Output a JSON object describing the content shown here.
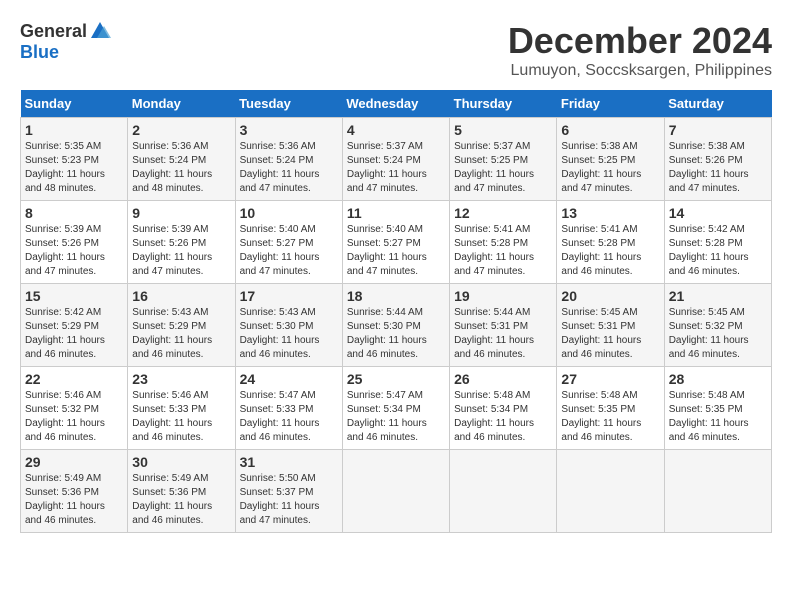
{
  "header": {
    "logo_general": "General",
    "logo_blue": "Blue",
    "title": "December 2024",
    "location": "Lumuyon, Soccsksargen, Philippines"
  },
  "days_of_week": [
    "Sunday",
    "Monday",
    "Tuesday",
    "Wednesday",
    "Thursday",
    "Friday",
    "Saturday"
  ],
  "weeks": [
    [
      {
        "day": "1",
        "sunrise": "5:35 AM",
        "sunset": "5:23 PM",
        "daylight": "11 hours and 48 minutes."
      },
      {
        "day": "2",
        "sunrise": "5:36 AM",
        "sunset": "5:24 PM",
        "daylight": "11 hours and 48 minutes."
      },
      {
        "day": "3",
        "sunrise": "5:36 AM",
        "sunset": "5:24 PM",
        "daylight": "11 hours and 47 minutes."
      },
      {
        "day": "4",
        "sunrise": "5:37 AM",
        "sunset": "5:24 PM",
        "daylight": "11 hours and 47 minutes."
      },
      {
        "day": "5",
        "sunrise": "5:37 AM",
        "sunset": "5:25 PM",
        "daylight": "11 hours and 47 minutes."
      },
      {
        "day": "6",
        "sunrise": "5:38 AM",
        "sunset": "5:25 PM",
        "daylight": "11 hours and 47 minutes."
      },
      {
        "day": "7",
        "sunrise": "5:38 AM",
        "sunset": "5:26 PM",
        "daylight": "11 hours and 47 minutes."
      }
    ],
    [
      {
        "day": "8",
        "sunrise": "5:39 AM",
        "sunset": "5:26 PM",
        "daylight": "11 hours and 47 minutes."
      },
      {
        "day": "9",
        "sunrise": "5:39 AM",
        "sunset": "5:26 PM",
        "daylight": "11 hours and 47 minutes."
      },
      {
        "day": "10",
        "sunrise": "5:40 AM",
        "sunset": "5:27 PM",
        "daylight": "11 hours and 47 minutes."
      },
      {
        "day": "11",
        "sunrise": "5:40 AM",
        "sunset": "5:27 PM",
        "daylight": "11 hours and 47 minutes."
      },
      {
        "day": "12",
        "sunrise": "5:41 AM",
        "sunset": "5:28 PM",
        "daylight": "11 hours and 47 minutes."
      },
      {
        "day": "13",
        "sunrise": "5:41 AM",
        "sunset": "5:28 PM",
        "daylight": "11 hours and 46 minutes."
      },
      {
        "day": "14",
        "sunrise": "5:42 AM",
        "sunset": "5:28 PM",
        "daylight": "11 hours and 46 minutes."
      }
    ],
    [
      {
        "day": "15",
        "sunrise": "5:42 AM",
        "sunset": "5:29 PM",
        "daylight": "11 hours and 46 minutes."
      },
      {
        "day": "16",
        "sunrise": "5:43 AM",
        "sunset": "5:29 PM",
        "daylight": "11 hours and 46 minutes."
      },
      {
        "day": "17",
        "sunrise": "5:43 AM",
        "sunset": "5:30 PM",
        "daylight": "11 hours and 46 minutes."
      },
      {
        "day": "18",
        "sunrise": "5:44 AM",
        "sunset": "5:30 PM",
        "daylight": "11 hours and 46 minutes."
      },
      {
        "day": "19",
        "sunrise": "5:44 AM",
        "sunset": "5:31 PM",
        "daylight": "11 hours and 46 minutes."
      },
      {
        "day": "20",
        "sunrise": "5:45 AM",
        "sunset": "5:31 PM",
        "daylight": "11 hours and 46 minutes."
      },
      {
        "day": "21",
        "sunrise": "5:45 AM",
        "sunset": "5:32 PM",
        "daylight": "11 hours and 46 minutes."
      }
    ],
    [
      {
        "day": "22",
        "sunrise": "5:46 AM",
        "sunset": "5:32 PM",
        "daylight": "11 hours and 46 minutes."
      },
      {
        "day": "23",
        "sunrise": "5:46 AM",
        "sunset": "5:33 PM",
        "daylight": "11 hours and 46 minutes."
      },
      {
        "day": "24",
        "sunrise": "5:47 AM",
        "sunset": "5:33 PM",
        "daylight": "11 hours and 46 minutes."
      },
      {
        "day": "25",
        "sunrise": "5:47 AM",
        "sunset": "5:34 PM",
        "daylight": "11 hours and 46 minutes."
      },
      {
        "day": "26",
        "sunrise": "5:48 AM",
        "sunset": "5:34 PM",
        "daylight": "11 hours and 46 minutes."
      },
      {
        "day": "27",
        "sunrise": "5:48 AM",
        "sunset": "5:35 PM",
        "daylight": "11 hours and 46 minutes."
      },
      {
        "day": "28",
        "sunrise": "5:48 AM",
        "sunset": "5:35 PM",
        "daylight": "11 hours and 46 minutes."
      }
    ],
    [
      {
        "day": "29",
        "sunrise": "5:49 AM",
        "sunset": "5:36 PM",
        "daylight": "11 hours and 46 minutes."
      },
      {
        "day": "30",
        "sunrise": "5:49 AM",
        "sunset": "5:36 PM",
        "daylight": "11 hours and 46 minutes."
      },
      {
        "day": "31",
        "sunrise": "5:50 AM",
        "sunset": "5:37 PM",
        "daylight": "11 hours and 47 minutes."
      },
      null,
      null,
      null,
      null
    ]
  ]
}
